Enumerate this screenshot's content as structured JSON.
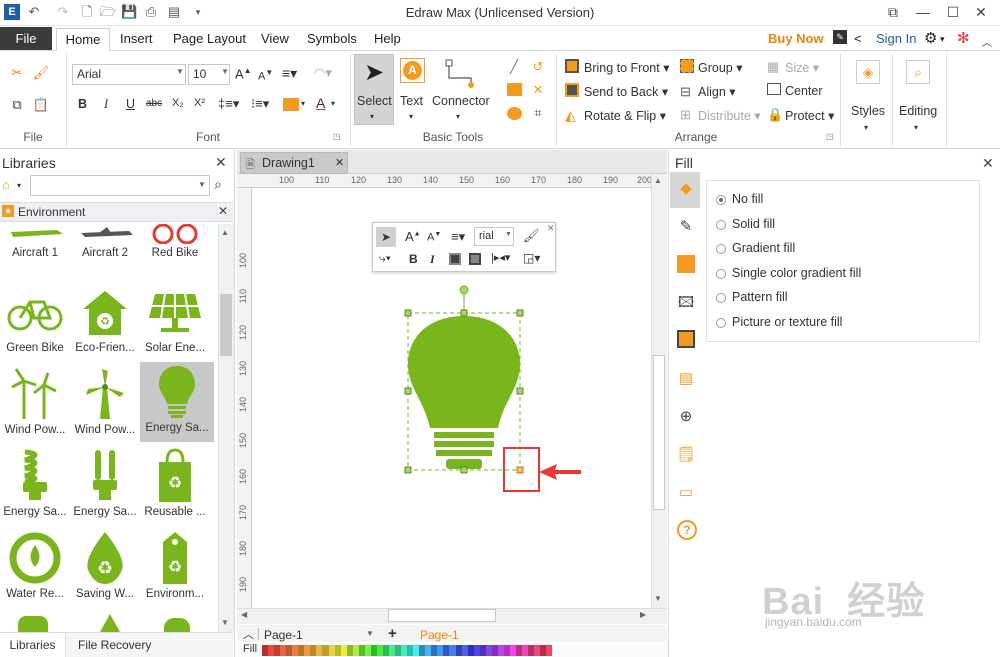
{
  "app": {
    "title": "Edraw Max (Unlicensed Version)"
  },
  "menu": {
    "file": "File",
    "home": "Home",
    "insert": "Insert",
    "page_layout": "Page Layout",
    "view": "View",
    "symbols": "Symbols",
    "help": "Help",
    "buy_now": "Buy Now",
    "sign_in": "Sign In"
  },
  "ribbon": {
    "font": {
      "name": "Arial",
      "size": "10",
      "label": "Font"
    },
    "file_group": {
      "label": "File"
    },
    "basic_tools": {
      "label": "Basic Tools",
      "select": "Select",
      "text": "Text",
      "connector": "Connector"
    },
    "arrange": {
      "label": "Arrange",
      "bring_to_front": "Bring to Front",
      "send_to_back": "Send to Back",
      "rotate_flip": "Rotate & Flip",
      "group": "Group",
      "align": "Align",
      "distribute": "Distribute",
      "size": "Size",
      "center": "Center",
      "protect": "Protect"
    },
    "styles": "Styles",
    "editing": "Editing"
  },
  "libraries": {
    "title": "Libraries",
    "category": "Environment",
    "items": [
      {
        "label": "Aircraft 1"
      },
      {
        "label": "Aircraft 2"
      },
      {
        "label": "Red Bike"
      },
      {
        "label": "Green Bike"
      },
      {
        "label": "Eco-Frien..."
      },
      {
        "label": "Solar Ene..."
      },
      {
        "label": "Wind Pow..."
      },
      {
        "label": "Wind Pow..."
      },
      {
        "label": "Energy Sa..."
      },
      {
        "label": "Energy Sa..."
      },
      {
        "label": "Energy Sa..."
      },
      {
        "label": "Reusable ..."
      },
      {
        "label": "Water Re..."
      },
      {
        "label": "Saving W..."
      },
      {
        "label": "Environm..."
      }
    ],
    "bottom_tabs": {
      "libraries": "Libraries",
      "file_recovery": "File Recovery"
    }
  },
  "document": {
    "tab": "Drawing1",
    "ruler_h": [
      "100",
      "110",
      "120",
      "130",
      "140",
      "150",
      "160",
      "170",
      "180",
      "190",
      "200"
    ],
    "ruler_v": [
      "100",
      "110",
      "120",
      "130",
      "140",
      "150",
      "160",
      "170",
      "180",
      "190"
    ],
    "float_font": "rial",
    "page_select": "Page-1",
    "page_tab": "Page-1",
    "fill_label": "Fill"
  },
  "fill_panel": {
    "title": "Fill",
    "options": [
      {
        "label": "No fill",
        "selected": true
      },
      {
        "label": "Solid fill",
        "selected": false
      },
      {
        "label": "Gradient fill",
        "selected": false
      },
      {
        "label": "Single color gradient fill",
        "selected": false
      },
      {
        "label": "Pattern fill",
        "selected": false
      },
      {
        "label": "Picture or texture fill",
        "selected": false
      }
    ]
  },
  "watermark": {
    "brand": "Bai  经验",
    "url": "jingyan.baidu.com"
  },
  "colors": {
    "green": "#7ab51d",
    "orange": "#f29b1f",
    "accent_red": "#e53935",
    "buy_now": "#e8860c"
  }
}
